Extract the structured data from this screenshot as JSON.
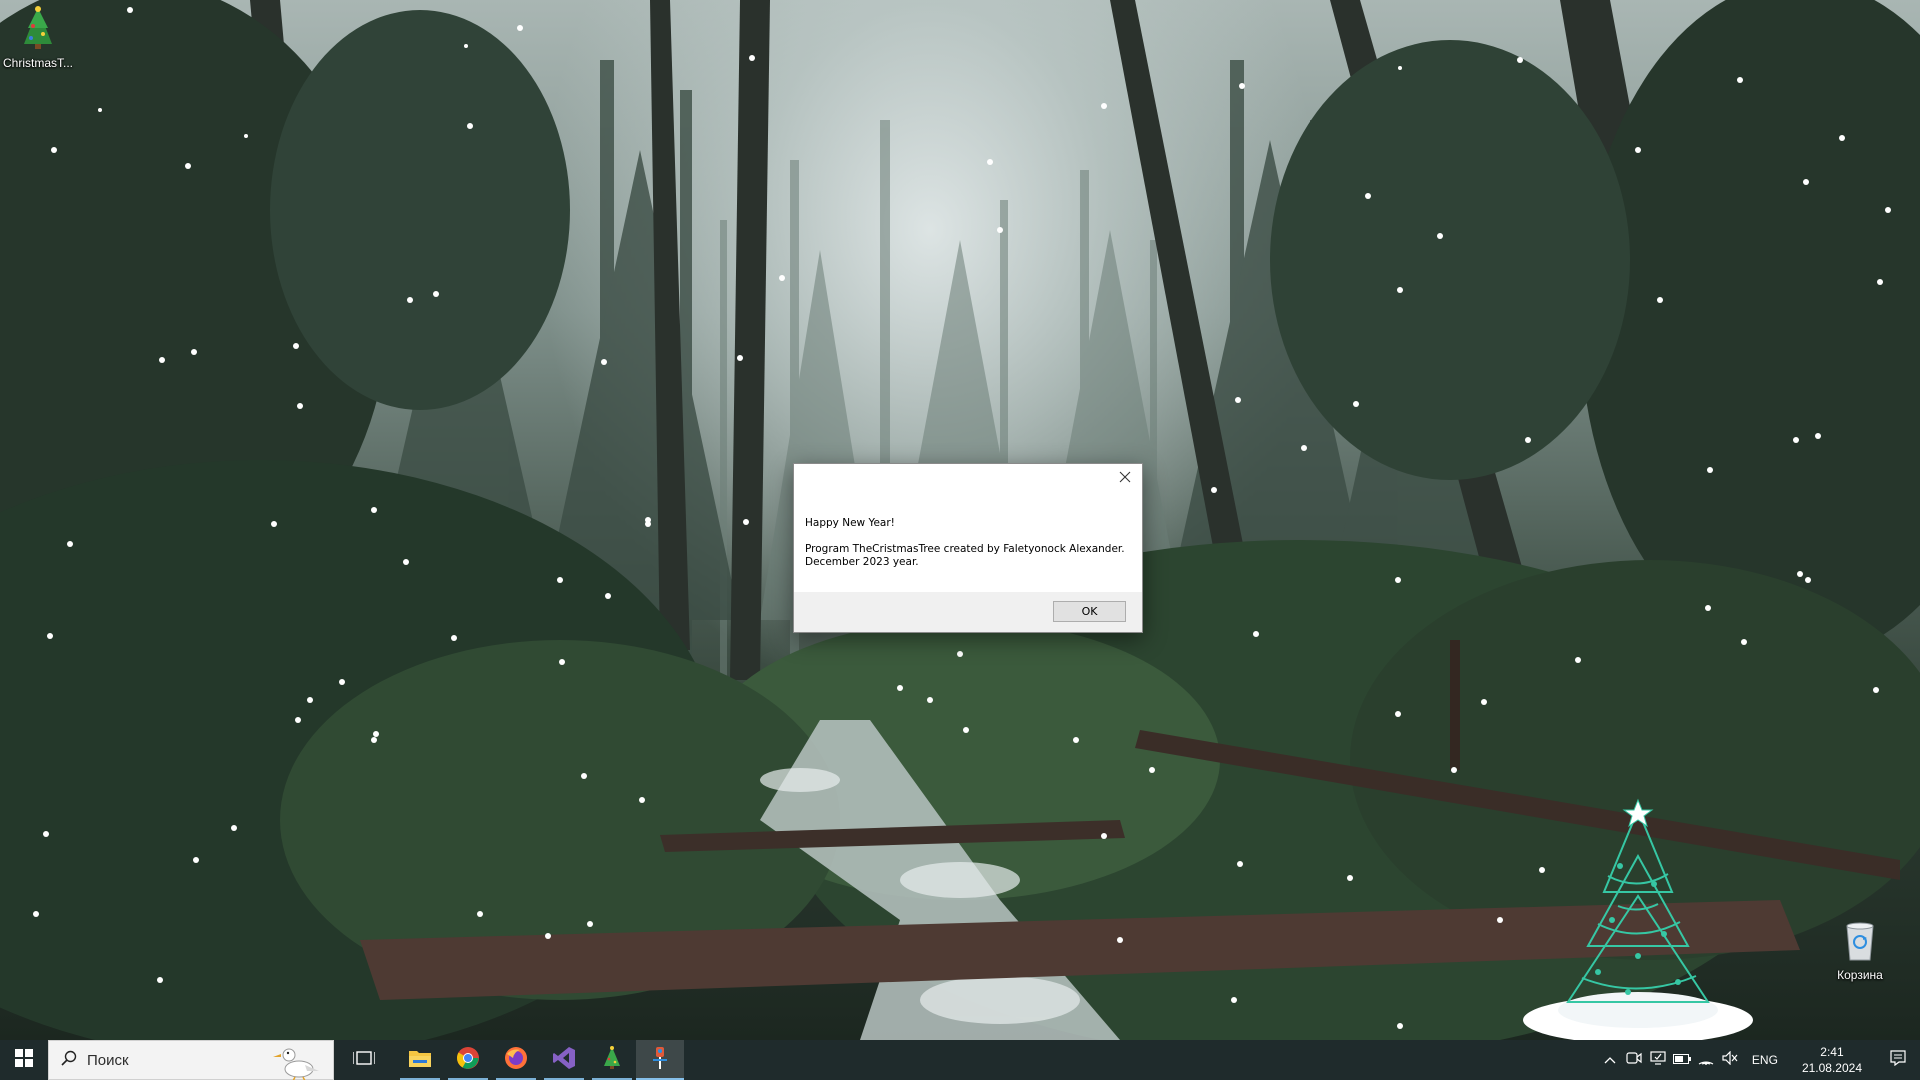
{
  "desktop": {
    "icons": [
      {
        "label": "ChristmasT...",
        "icon": "christmas-tree-icon"
      },
      {
        "label": "Корзина",
        "icon": "recycle-bin-icon"
      }
    ]
  },
  "dialog": {
    "line1": "Happy New Year!",
    "line2": "Program TheCristmasTree created by Faletyonock Alexander.",
    "line3": "December 2023 year.",
    "ok_label": "OK"
  },
  "taskbar": {
    "search_placeholder": "Поиск",
    "apps": [
      {
        "icon": "task-view-icon",
        "running": false
      },
      {
        "icon": "file-explorer-icon",
        "running": true
      },
      {
        "icon": "chrome-icon",
        "running": true
      },
      {
        "icon": "firefox-icon",
        "running": true
      },
      {
        "icon": "visual-studio-icon",
        "running": true
      },
      {
        "icon": "christmas-tree-app-icon",
        "running": true
      },
      {
        "icon": "tool-app-icon",
        "running": true,
        "active": true
      }
    ],
    "tray": {
      "language": "ENG",
      "time": "2:41",
      "date": "21.08.2024"
    }
  },
  "colors": {
    "taskbar": "#1f2b2c",
    "accent": "#86c0ea",
    "dialog_footer": "#f0f0f0"
  }
}
